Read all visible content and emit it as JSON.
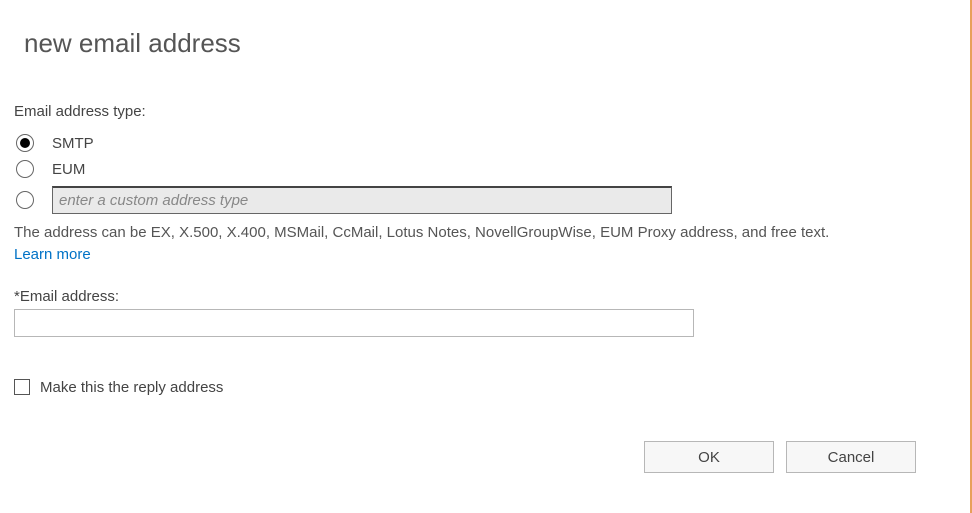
{
  "title": "new email address",
  "type_section": {
    "label": "Email address type:",
    "options": {
      "smtp": "SMTP",
      "eum": "EUM",
      "custom_placeholder": "enter a custom address type",
      "custom_value": ""
    },
    "selected": "smtp"
  },
  "help_text": {
    "line": "The address can be EX, X.500, X.400, MSMail, CcMail, Lotus Notes, NovellGroupWise, EUM Proxy address, and free text. ",
    "learn_more": "Learn more"
  },
  "email_field": {
    "label": "*Email address:",
    "value": ""
  },
  "reply_checkbox": {
    "label": "Make this the reply address",
    "checked": false
  },
  "buttons": {
    "ok": "OK",
    "cancel": "Cancel"
  }
}
